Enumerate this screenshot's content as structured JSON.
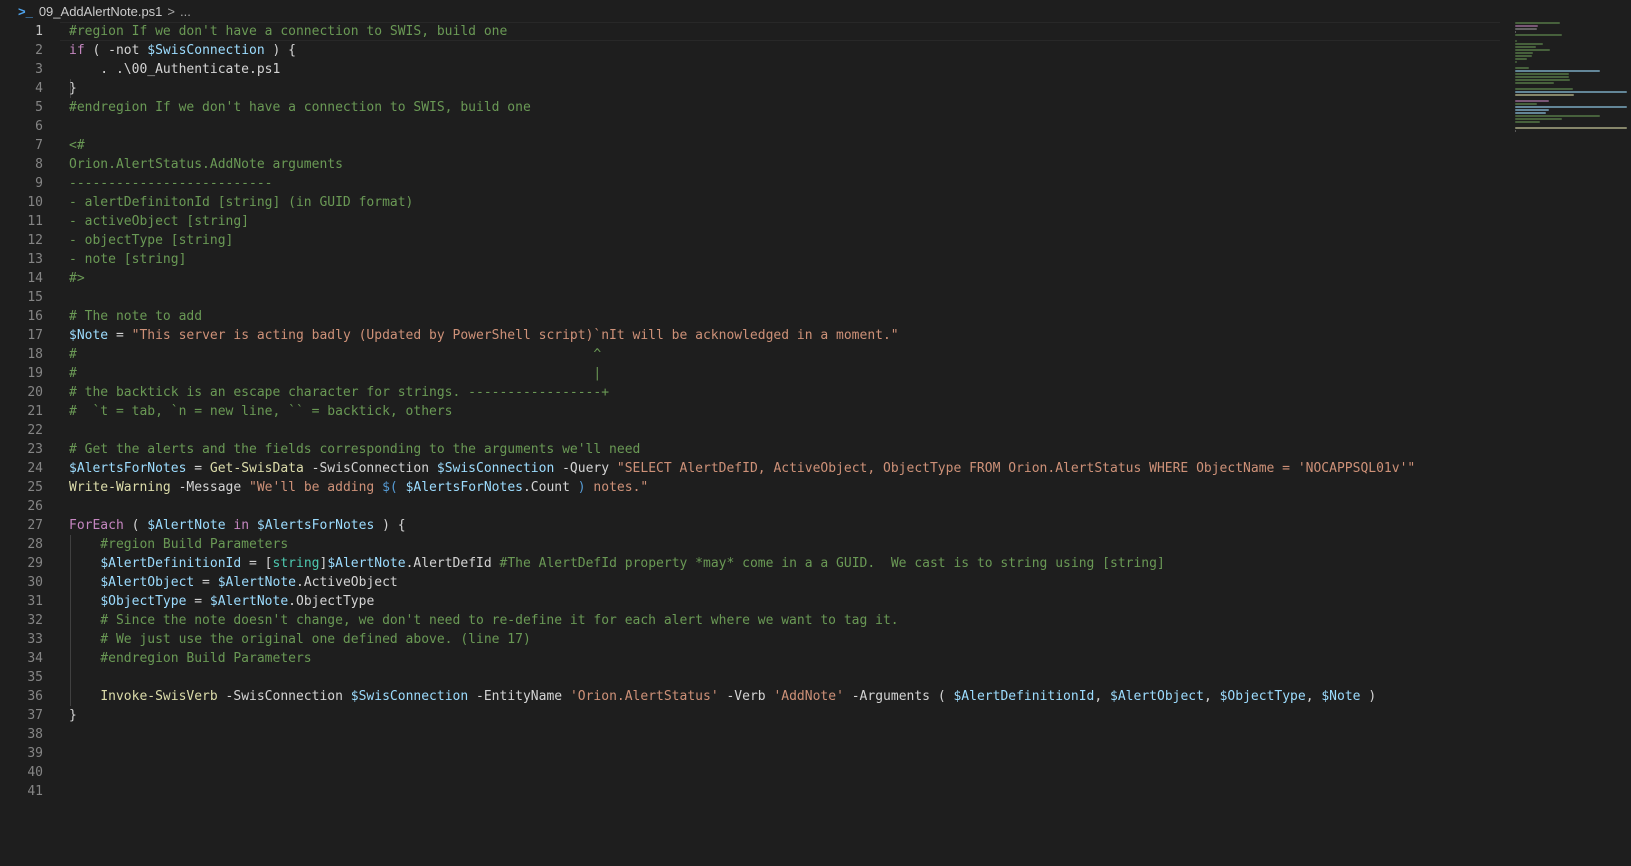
{
  "breadcrumb": {
    "file": "09_AddAlertNote.ps1",
    "sep": ">",
    "more": "..."
  },
  "icons": {
    "file_icon": "powershell-icon"
  },
  "colors": {
    "background": "#1e1e1e",
    "comment": "#6a9955",
    "keyword": "#c586c0",
    "variable": "#9cdcfe",
    "string": "#ce9178",
    "function": "#dcdcaa",
    "type": "#4ec9b0"
  },
  "editor": {
    "current_line": 1,
    "lines": [
      [
        [
          "c",
          "#region If we don't have a connection to SWIS, build one"
        ]
      ],
      [
        [
          "k",
          "if"
        ],
        [
          "p",
          " ( -not "
        ],
        [
          "v",
          "$SwisConnection"
        ],
        [
          "p",
          " ) {"
        ]
      ],
      [
        [
          "p",
          "    . .\\00_Authenticate.ps1"
        ]
      ],
      [
        [
          "p",
          "}"
        ]
      ],
      [
        [
          "c",
          "#endregion If we don't have a connection to SWIS, build one"
        ]
      ],
      [],
      [
        [
          "c",
          "<#"
        ]
      ],
      [
        [
          "c",
          "Orion.AlertStatus.AddNote arguments"
        ]
      ],
      [
        [
          "c",
          "--------------------------"
        ]
      ],
      [
        [
          "c",
          "- alertDefinitonId [string] (in GUID format)"
        ]
      ],
      [
        [
          "c",
          "- activeObject [string]"
        ]
      ],
      [
        [
          "c",
          "- objectType [string]"
        ]
      ],
      [
        [
          "c",
          "- note [string]"
        ]
      ],
      [
        [
          "c",
          "#>"
        ]
      ],
      [],
      [
        [
          "c",
          "# The note to add"
        ]
      ],
      [
        [
          "v",
          "$Note"
        ],
        [
          "p",
          " = "
        ],
        [
          "s",
          "\"This server is acting badly (Updated by PowerShell script)`nIt will be acknowledged in a moment.\""
        ]
      ],
      [
        [
          "c",
          "#                                                                  ^"
        ]
      ],
      [
        [
          "c",
          "#                                                                  |"
        ]
      ],
      [
        [
          "c",
          "# the backtick is an escape character for strings. -----------------+"
        ]
      ],
      [
        [
          "c",
          "#  `t = tab, `n = new line, `` = backtick, others"
        ]
      ],
      [],
      [
        [
          "c",
          "# Get the alerts and the fields corresponding to the arguments we'll need"
        ]
      ],
      [
        [
          "v",
          "$AlertsForNotes"
        ],
        [
          "p",
          " = "
        ],
        [
          "f",
          "Get-SwisData"
        ],
        [
          "p",
          " -SwisConnection "
        ],
        [
          "v",
          "$SwisConnection"
        ],
        [
          "p",
          " -Query "
        ],
        [
          "s",
          "\"SELECT AlertDefID, ActiveObject, ObjectType FROM Orion.AlertStatus WHERE ObjectName = 'NOCAPPSQL01v'\""
        ]
      ],
      [
        [
          "f",
          "Write-Warning"
        ],
        [
          "p",
          " -Message "
        ],
        [
          "s",
          "\"We'll be adding "
        ],
        [
          "b",
          "$( "
        ],
        [
          "v",
          "$AlertsForNotes"
        ],
        [
          "p",
          ".Count"
        ],
        [
          "b",
          " )"
        ],
        [
          "s",
          " notes.\""
        ]
      ],
      [],
      [
        [
          "k",
          "ForEach"
        ],
        [
          "p",
          " ( "
        ],
        [
          "v",
          "$AlertNote"
        ],
        [
          "k",
          " in "
        ],
        [
          "v",
          "$AlertsForNotes"
        ],
        [
          "p",
          " ) {"
        ]
      ],
      [
        [
          "c",
          "    #region Build Parameters"
        ]
      ],
      [
        [
          "p",
          "    "
        ],
        [
          "v",
          "$AlertDefinitionId"
        ],
        [
          "p",
          " = ["
        ],
        [
          "t",
          "string"
        ],
        [
          "p",
          "]"
        ],
        [
          "v",
          "$AlertNote"
        ],
        [
          "p",
          ".AlertDefId "
        ],
        [
          "c",
          "#The AlertDefId property *may* come in a a GUID.  We cast is to string using [string]"
        ]
      ],
      [
        [
          "p",
          "    "
        ],
        [
          "v",
          "$AlertObject"
        ],
        [
          "p",
          " = "
        ],
        [
          "v",
          "$AlertNote"
        ],
        [
          "p",
          ".ActiveObject"
        ]
      ],
      [
        [
          "p",
          "    "
        ],
        [
          "v",
          "$ObjectType"
        ],
        [
          "p",
          " = "
        ],
        [
          "v",
          "$AlertNote"
        ],
        [
          "p",
          ".ObjectType"
        ]
      ],
      [
        [
          "c",
          "    # Since the note doesn't change, we don't need to re-define it for each alert where we want to tag it."
        ]
      ],
      [
        [
          "c",
          "    # We just use the original one defined above. (line 17)"
        ]
      ],
      [
        [
          "c",
          "    #endregion Build Parameters"
        ]
      ],
      [],
      [
        [
          "p",
          "    "
        ],
        [
          "f",
          "Invoke-SwisVerb"
        ],
        [
          "p",
          " -SwisConnection "
        ],
        [
          "v",
          "$SwisConnection"
        ],
        [
          "p",
          " -EntityName "
        ],
        [
          "s",
          "'Orion.AlertStatus'"
        ],
        [
          "p",
          " -Verb "
        ],
        [
          "s",
          "'AddNote'"
        ],
        [
          "p",
          " -Arguments ( "
        ],
        [
          "v",
          "$AlertDefinitionId"
        ],
        [
          "p",
          ", "
        ],
        [
          "v",
          "$AlertObject"
        ],
        [
          "p",
          ", "
        ],
        [
          "v",
          "$ObjectType"
        ],
        [
          "p",
          ", "
        ],
        [
          "v",
          "$Note"
        ],
        [
          "p",
          " )"
        ]
      ],
      [
        [
          "p",
          "}"
        ]
      ],
      [],
      [],
      [],
      []
    ]
  }
}
